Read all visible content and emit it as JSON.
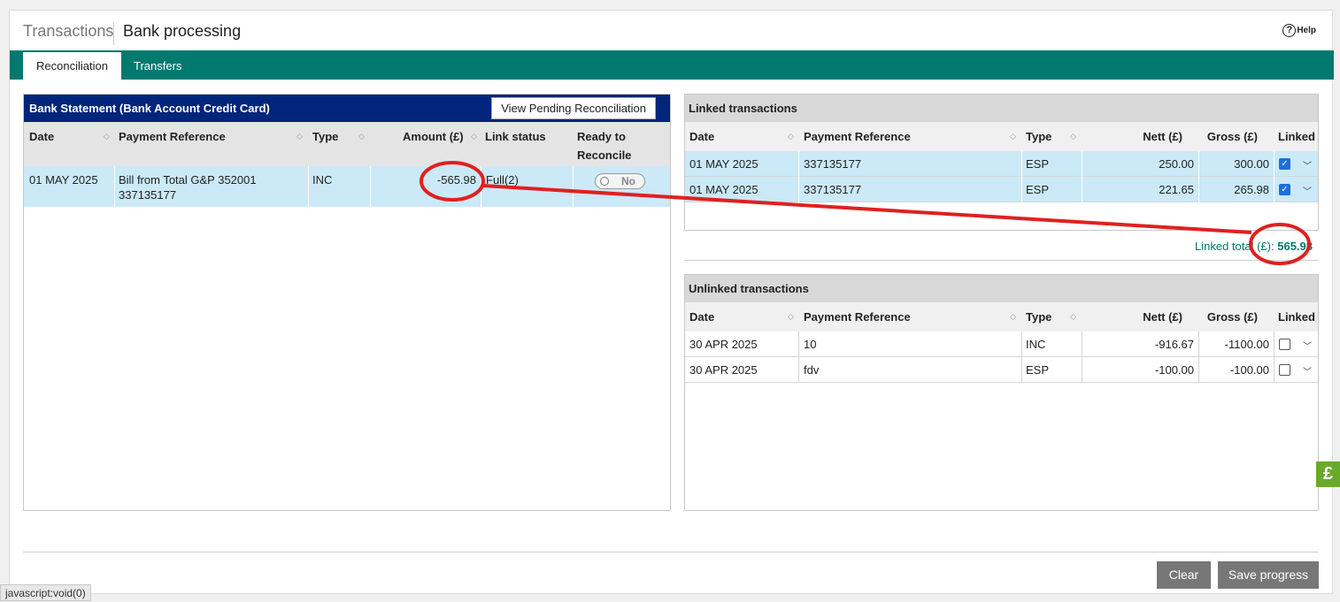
{
  "header": {
    "breadcrumb_1": "Transactions",
    "breadcrumb_2": "Bank processing",
    "help_label": "Help",
    "help_icon": "?"
  },
  "tabs": [
    {
      "label": "Reconciliation",
      "active": true
    },
    {
      "label": "Transfers",
      "active": false
    }
  ],
  "bank_statement": {
    "title": "Bank Statement (Bank Account Credit Card)",
    "pending_button": "View Pending Reconciliation",
    "columns": [
      "Date",
      "Payment Reference",
      "Type",
      "Amount (£)",
      "Link status",
      "Ready to",
      "Reconcile"
    ],
    "rows": [
      {
        "date": "01 MAY 2025",
        "ref_line1": "Bill from Total G&P 352001",
        "ref_line2": "337135177",
        "type": "INC",
        "amount": "-565.98",
        "link_status": "Full(2)",
        "ready": "No"
      }
    ]
  },
  "linked": {
    "title": "Linked transactions",
    "columns": [
      "Date",
      "Payment Reference",
      "Type",
      "Nett (£)",
      "Gross (£)",
      "Linked"
    ],
    "rows": [
      {
        "date": "01 MAY 2025",
        "ref": "337135177",
        "type": "ESP",
        "nett": "250.00",
        "gross": "300.00",
        "checked": true
      },
      {
        "date": "01 MAY 2025",
        "ref": "337135177",
        "type": "ESP",
        "nett": "221.65",
        "gross": "265.98",
        "checked": true
      }
    ],
    "total_label": "Linked total (£):",
    "total_value": "565.98"
  },
  "unlinked": {
    "title": "Unlinked transactions",
    "columns": [
      "Date",
      "Payment Reference",
      "Type",
      "Nett (£)",
      "Gross (£)",
      "Linked"
    ],
    "rows": [
      {
        "date": "30 APR 2025",
        "ref": "10",
        "type": "INC",
        "nett": "-916.67",
        "gross": "-1100.00",
        "checked": false
      },
      {
        "date": "30 APR 2025",
        "ref": "fdv",
        "type": "ESP",
        "nett": "-100.00",
        "gross": "-100.00",
        "checked": false
      }
    ]
  },
  "footer": {
    "clear_label": "Clear",
    "save_label": "Save progress"
  },
  "status_bar": "javascript:void(0)",
  "side_icon": "£",
  "colors": {
    "teal": "#00796e",
    "navy": "#00257a",
    "row_highlight": "#cbe9f7",
    "annotation_red": "#e02020"
  }
}
